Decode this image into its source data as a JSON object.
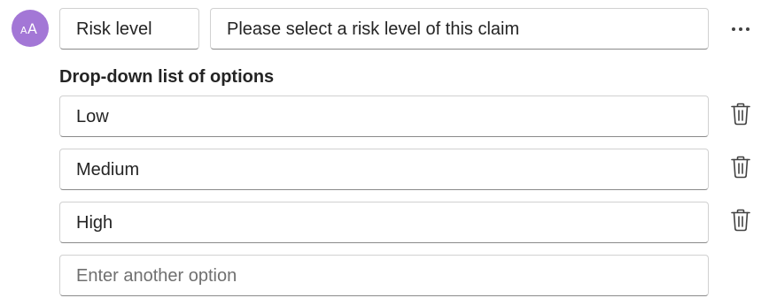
{
  "avatar": {
    "icon": "font-size-icon",
    "color": "#a377d6"
  },
  "question": {
    "label_value": "Risk level",
    "description_value": "Please select a risk level of this claim",
    "more_icon": "ellipsis-icon"
  },
  "options_section": {
    "title": "Drop-down list of options",
    "options": [
      {
        "value": "Low"
      },
      {
        "value": "Medium"
      },
      {
        "value": "High"
      }
    ],
    "new_option_placeholder": "Enter another option",
    "delete_icon": "trash-icon"
  }
}
